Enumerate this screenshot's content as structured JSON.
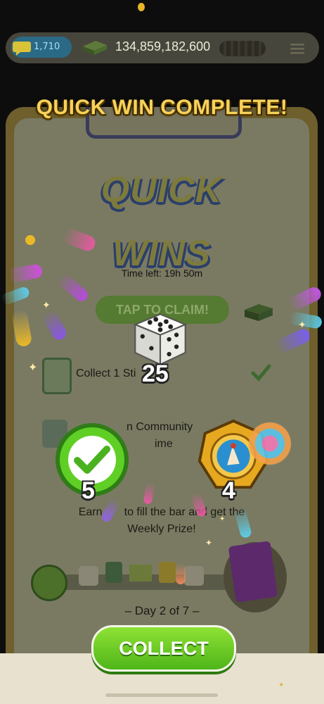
{
  "top_bar": {
    "level_text": "1,710",
    "cash_text": "134,859,182,600"
  },
  "heading": "QUICK WIN COMPLETE!",
  "panel": {
    "title": "QUICK WINS",
    "time_left": "Time left: 19h 50m",
    "tap_to_claim": "TAP TO CLAIM!",
    "tasks": [
      {
        "label": "Collect 1 Sti"
      },
      {
        "label": "n Community",
        "sub": "ime"
      }
    ],
    "earn_text_line1": "Earn       to fill the bar and get the",
    "earn_text_line2": "Weekly Prize!",
    "day_text": "– Day 2 of 7 –"
  },
  "rewards": {
    "dice": "25",
    "quick_wins": "5",
    "tokens": "4"
  },
  "collect_label": "COLLECT",
  "colors": {
    "heading": "#f7d25b",
    "collect_green": "#4fb51a",
    "check_green": "#52c223"
  }
}
